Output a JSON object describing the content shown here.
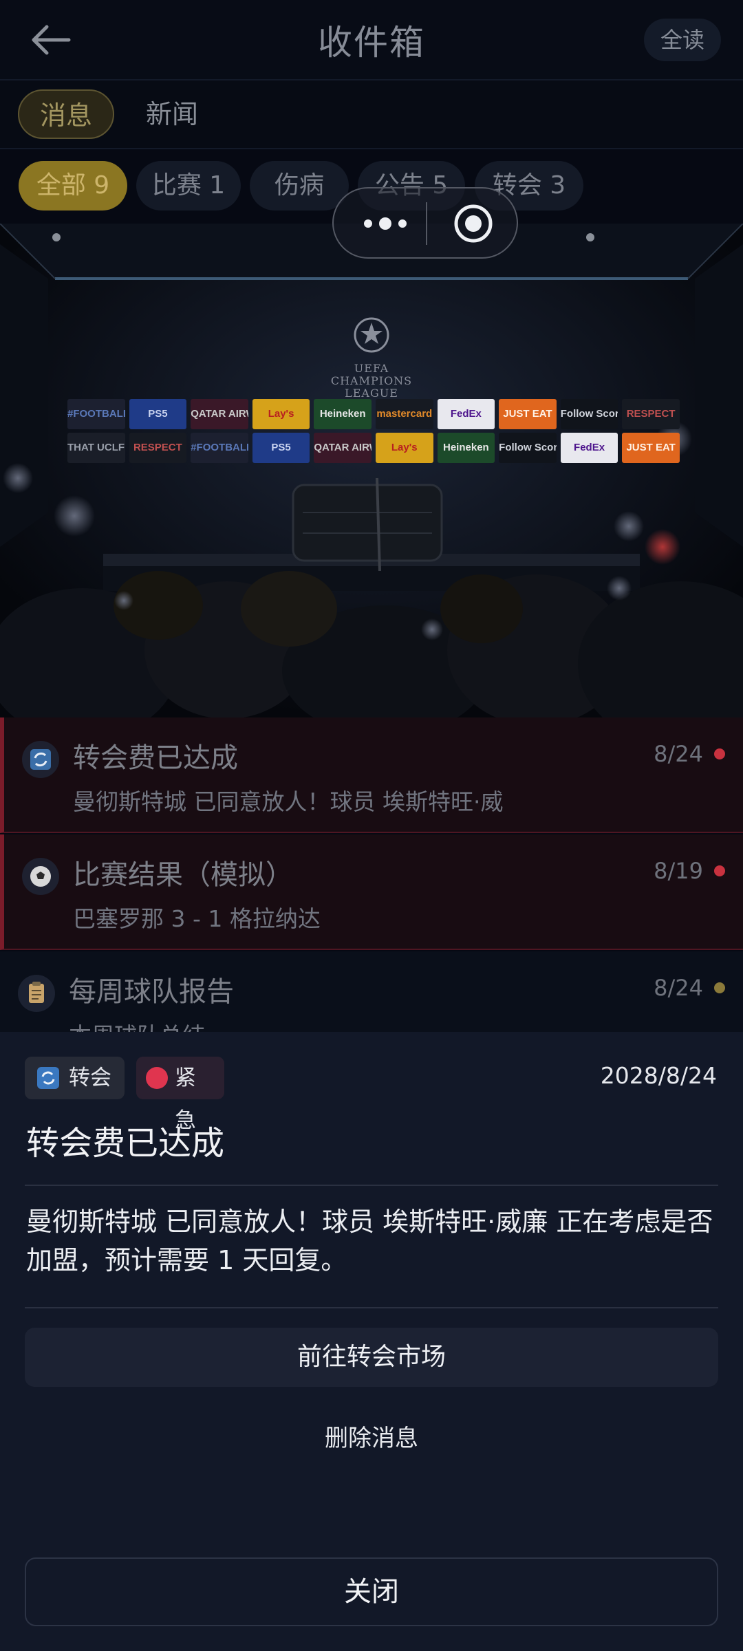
{
  "header": {
    "title": "收件箱",
    "read_all_label": "全读",
    "back_icon": "arrow-left-icon"
  },
  "tabs": [
    {
      "label": "消息",
      "active": true
    },
    {
      "label": "新闻",
      "active": false
    }
  ],
  "filters": [
    {
      "label": "全部 9",
      "active": true
    },
    {
      "label": "比赛 1",
      "active": false
    },
    {
      "label": "伤病",
      "active": false
    },
    {
      "label": "公告 5",
      "active": false
    },
    {
      "label": "转会 3",
      "active": false
    }
  ],
  "capsule": {
    "more_icon": "more-dots-icon",
    "close_icon": "target-circle-icon"
  },
  "photo": {
    "logo_text": "UEFA CHAMPIONS LEAGUE",
    "sponsors_row1": [
      "#FOOTBALL",
      "PS5",
      "QATAR AIRWAYS",
      "Lay's",
      "Heineken",
      "mastercard",
      "FedEx",
      "JUST EAT",
      "Follow Scores",
      "RESPECT"
    ],
    "sponsors_row2": [
      "THAT UCLFEELING",
      "RESPECT",
      "#FOOTBALL",
      "PS5",
      "QATAR AIRWAYS",
      "Lay's",
      "Heineken",
      "Follow Scores",
      "FedEx",
      "JUST EAT"
    ]
  },
  "messages": [
    {
      "icon": "transfer-icon",
      "title": "转会费已达成",
      "date": "8/24",
      "preview": "曼彻斯特城 已同意放人！球员 埃斯特旺·威",
      "dot_color": "#c8323f",
      "urgent": true
    },
    {
      "icon": "soccer-ball-icon",
      "title": "比赛结果（模拟）",
      "date": "8/19",
      "preview": "巴塞罗那 3 - 1 格拉纳达",
      "dot_color": "#c8323f",
      "urgent": true
    },
    {
      "icon": "clipboard-icon",
      "title": "每周球队报告",
      "date": "8/24",
      "preview": "本周球队总结",
      "dot_color": "#8b7a3a",
      "urgent": false
    }
  ],
  "detail": {
    "tag_category": "转会",
    "tag_priority": "紧急",
    "date": "2028/8/24",
    "title": "转会费已达成",
    "body": "曼彻斯特城 已同意放人！球员 埃斯特旺·威廉 正在考虑是否加盟，预计需要 1 天回复。",
    "primary_action": "前往转会市场",
    "delete_action": "删除消息",
    "close_action": "关闭"
  },
  "colors": {
    "accent_gold": "#8b7622",
    "urgent_red": "#e0354f",
    "sheet_bg": "#121828",
    "page_bg": "#060913"
  }
}
